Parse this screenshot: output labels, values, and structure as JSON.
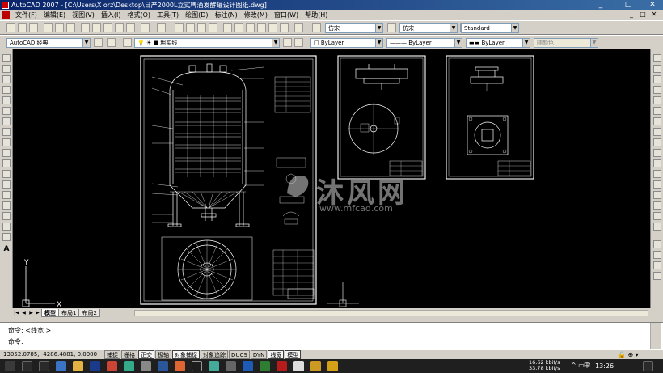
{
  "window": {
    "title": "AutoCAD 2007 - [C:\\Users\\X orz\\Desktop\\日产2000L立式啤酒发酵罐设计图纸.dwg]",
    "controls": [
      "_",
      "□",
      "✕"
    ]
  },
  "menu": {
    "items": [
      "文件(F)",
      "编辑(E)",
      "视图(V)",
      "插入(I)",
      "格式(O)",
      "工具(T)",
      "绘图(D)",
      "标注(N)",
      "修改(M)",
      "窗口(W)",
      "帮助(H)"
    ]
  },
  "toolbar2": {
    "workspace": "AutoCAD 经典",
    "layer": "粗实线",
    "color": "ByLayer",
    "linetype": "ByLayer",
    "lineweight": "ByLayer",
    "plotstyle": "随颜色"
  },
  "toolbar1": {
    "text_style": "仿宋",
    "dim_style": "仿宋",
    "table_style": "Standard"
  },
  "drawing": {
    "sheet1_title_num": "1",
    "watermark_text": "沐风网",
    "watermark_url": "www.mfcad.com"
  },
  "layout_tabs": [
    "模型",
    "布局1",
    "布局2"
  ],
  "ucs": {
    "x": "X",
    "y": "Y"
  },
  "command": {
    "line1": "命令: <线宽 >",
    "line2": "命令:"
  },
  "status": {
    "coordinates": "13052.0785, -4286.4881, 0.0000",
    "buttons": [
      {
        "label": "捕捉",
        "on": false
      },
      {
        "label": "栅格",
        "on": false
      },
      {
        "label": "正交",
        "on": true
      },
      {
        "label": "极轴",
        "on": false
      },
      {
        "label": "对象捕捉",
        "on": true
      },
      {
        "label": "对象追踪",
        "on": false
      },
      {
        "label": "DUCS",
        "on": false
      },
      {
        "label": "DYN",
        "on": false
      },
      {
        "label": "线宽",
        "on": true
      },
      {
        "label": "模型",
        "on": true
      }
    ]
  },
  "taskbar": {
    "net_up": "16.62 kbit/s",
    "net_down": "33.78 kbit/s",
    "lang": "中",
    "time": "13:26"
  },
  "colors": {
    "canvas": "#000000",
    "drawing_lines": "#ffffff",
    "title_bar": "#0a246a"
  }
}
